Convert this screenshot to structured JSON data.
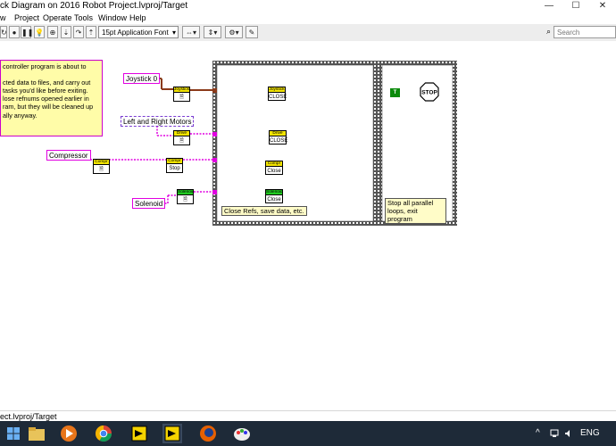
{
  "window": {
    "title": "ck Diagram on 2016 Robot Project.lvproj/Target",
    "minimize": "—",
    "maximize": "☐",
    "close": "✕"
  },
  "menu": [
    "w",
    "Project",
    "Operate",
    "Tools",
    "Window",
    "Help"
  ],
  "toolbar": {
    "font_selector": "15pt Application Font",
    "search_placeholder": "Search"
  },
  "comment_lines": [
    "controller program is about to",
    "",
    "cted data to files, and carry out",
    "tasks you'd like before exiting.",
    "lose refnums opened earlier in",
    "ram, but they will be cleaned up",
    "ally anyway."
  ],
  "controls": {
    "joystick": "Joystick 0",
    "motors": "Left and Right Motors",
    "compressor": "Compressor",
    "solenoid": "Solenoid"
  },
  "nodes": {
    "joystick_get": "Joystick",
    "joystick_close_hd": "Joystick",
    "joystick_close": "CLOSE",
    "drive_get": "Drive",
    "drive_close_hd": "Drive",
    "drive_close": "CLOSE",
    "compressor_get": "Compr",
    "compressor_stop_hd": "Compr",
    "compressor_stop": "Stop",
    "compressor_close_hd": "Compr",
    "compressor_close": "Close",
    "solenoid_get": "Solenoid",
    "solenoid_close_hd": "Solenoid",
    "solenoid_close": "Close"
  },
  "frame1_label": "Close Refs, save data, etc.",
  "frame2_label_lines": [
    "Stop all parallel",
    "loops, exit program"
  ],
  "bool_constant": "T",
  "stop_label": "STOP",
  "status_path": "ect.lvproj/Target",
  "tray": {
    "chevron": "^",
    "lang": "ENG"
  }
}
